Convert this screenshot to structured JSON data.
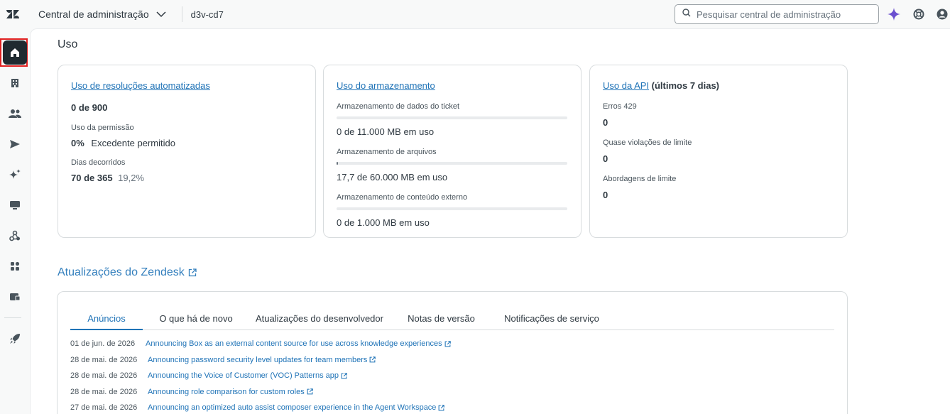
{
  "topbar": {
    "app_title": "Central de administração",
    "account": "d3v-cd7",
    "search_placeholder": "Pesquisar central de administração"
  },
  "usage": {
    "section_title": "Uso",
    "automated": {
      "title": "Uso de resoluções automatizadas",
      "count": "0 de 900",
      "permission_label": "Uso da permissão",
      "permission_pct": "0%",
      "permission_note": "Excedente permitido",
      "days_label": "Dias decorridos",
      "days_value": "70 de 365",
      "days_pct": "19,2%"
    },
    "storage": {
      "title": "Uso do armazenamento",
      "items": [
        {
          "label": "Armazenamento de dados do ticket",
          "value": "0",
          "suffix": " de 11.000 MB em uso",
          "fraction": 0
        },
        {
          "label": "Armazenamento de arquivos",
          "value": "17,7",
          "suffix": " de 60.000 MB em uso",
          "fraction": 0.000295
        },
        {
          "label": "Armazenamento de conteúdo externo",
          "value": "0",
          "suffix": " de 1.000 MB em uso",
          "fraction": 0
        }
      ]
    },
    "api": {
      "title": "Uso da API",
      "title_suffix": " (últimos 7 dias)",
      "items": [
        {
          "label": "Erros 429",
          "value": "0"
        },
        {
          "label": "Quase violações de limite",
          "value": "0"
        },
        {
          "label": "Abordagens de limite",
          "value": "0"
        }
      ]
    }
  },
  "updates": {
    "title": "Atualizações do Zendesk",
    "tabs": [
      "Anúncios",
      "O que há de novo",
      "Atualizações do desenvolvedor",
      "Notas de versão",
      "Notificações de serviço"
    ],
    "news": [
      {
        "date": "01 de jun. de 2026",
        "title": "Announcing Box as an external content source for use across knowledge experiences"
      },
      {
        "date": "28 de mai. de 2026",
        "title": "Announcing password security level updates for team members"
      },
      {
        "date": "28 de mai. de 2026",
        "title": "Announcing the Voice of Customer (VOC) Patterns app"
      },
      {
        "date": "28 de mai. de 2026",
        "title": "Announcing role comparison for custom roles"
      },
      {
        "date": "27 de mai. de 2026",
        "title": "Announcing an optimized auto assist composer experience in the Agent Workspace"
      }
    ]
  },
  "colors": {
    "link": "#1f73b7",
    "active_nav": "#1f2a30",
    "highlight": "#e02020",
    "ai_sparkle": "#6a4fcf"
  }
}
